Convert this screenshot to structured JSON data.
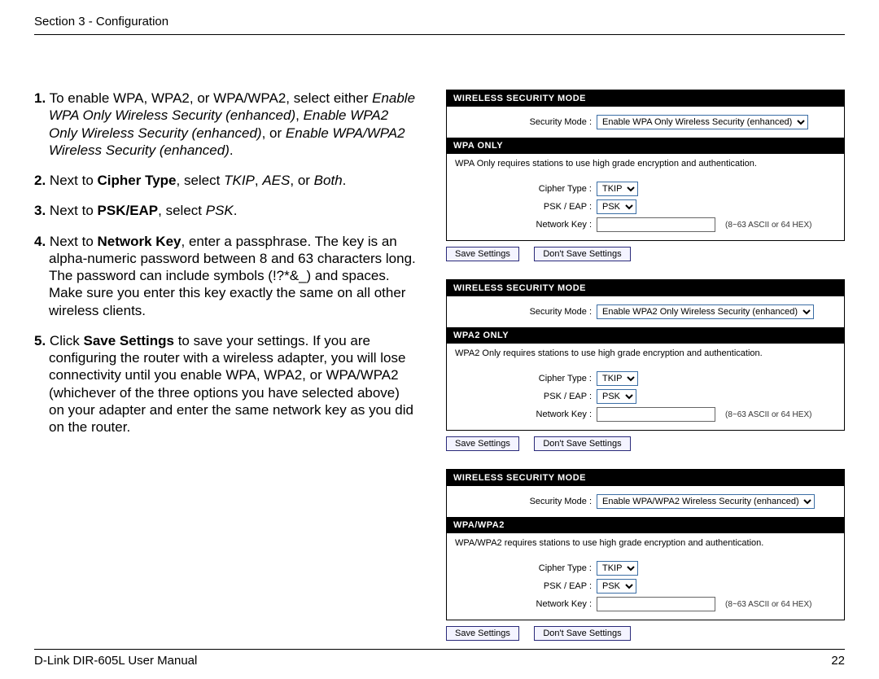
{
  "header": {
    "text": "Section 3 - Configuration"
  },
  "footer": {
    "left": "D-Link DIR-605L User Manual",
    "page": "22"
  },
  "steps": {
    "s1": {
      "num": "1.",
      "a": "To enable WPA, WPA2, or WPA/WPA2, select either ",
      "i1": "Enable WPA Only Wireless Security (enhanced)",
      "comma1": ", ",
      "i2": "Enable WPA2 Only Wireless Security (enhanced)",
      "or": ", or ",
      "i3": "Enable WPA/WPA2 Wireless Security (enhanced)",
      "dot": "."
    },
    "s2": {
      "num": "2.",
      "a": "Next to ",
      "b": "Cipher Type",
      "c": ", select ",
      "i1": "TKIP",
      "comma1": ", ",
      "i2": "AES",
      "or": ", or ",
      "i3": "Both",
      "dot": "."
    },
    "s3": {
      "num": "3.",
      "a": "Next to ",
      "b": "PSK/EAP",
      "c": ", select ",
      "i1": "PSK",
      "dot": "."
    },
    "s4": {
      "num": "4.",
      "a": "Next to ",
      "b": "Network Key",
      "c": ", enter a passphrase. The key is an alpha-numeric password between 8 and 63 characters long. The password can include symbols (!?*&_) and spaces. Make sure you enter this key exactly the same on all other wireless clients."
    },
    "s5": {
      "num": "5.",
      "a": "Click ",
      "b": "Save Settings",
      "c": " to save your settings. If you are configuring the router with a wireless adapter, you will lose connectivity until you enable WPA, WPA2, or WPA/WPA2 (whichever of the three options you have selected above) on your adapter and enter the same network key as you did on the router."
    }
  },
  "ui": {
    "barMode": "WIRELESS SECURITY MODE",
    "lblMode": "Security Mode :",
    "lblCipher": "Cipher Type :",
    "lblPSK": "PSK / EAP :",
    "lblKey": "Network Key :",
    "hint": "(8~63 ASCII or 64 HEX)",
    "save": "Save Settings",
    "dont": "Don't Save Settings",
    "cipher": "TKIP",
    "psk": "PSK",
    "p1": {
      "mode": "Enable WPA Only Wireless Security (enhanced)",
      "bar2": "WPA ONLY",
      "desc": "WPA Only requires stations to use high grade encryption and authentication."
    },
    "p2": {
      "mode": "Enable WPA2 Only Wireless Security (enhanced)",
      "bar2": "WPA2 ONLY",
      "desc": "WPA2 Only requires stations to use high grade encryption and authentication."
    },
    "p3": {
      "mode": "Enable WPA/WPA2 Wireless Security (enhanced)",
      "bar2": "WPA/WPA2",
      "desc": "WPA/WPA2 requires stations to use high grade encryption and authentication."
    }
  }
}
